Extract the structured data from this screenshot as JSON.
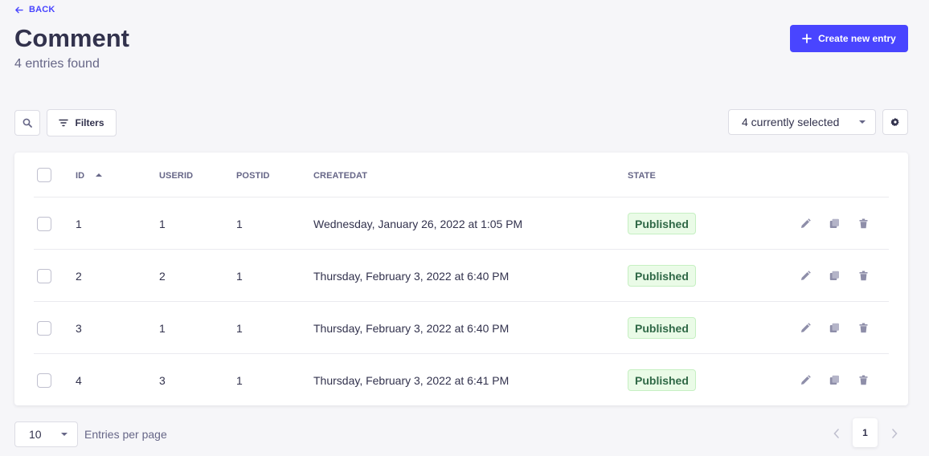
{
  "header": {
    "back_label": "BACK",
    "title": "Comment",
    "subtitle": "4 entries found",
    "create_label": "Create new entry"
  },
  "toolbar": {
    "filters_label": "Filters",
    "columns_select": "4 currently selected"
  },
  "table": {
    "columns": [
      "ID",
      "USERID",
      "POSTID",
      "CREATEDAT",
      "STATE"
    ],
    "rows": [
      {
        "id": "1",
        "userid": "1",
        "postid": "1",
        "createdat": "Wednesday, January 26, 2022 at 1:05 PM",
        "state": "Published"
      },
      {
        "id": "2",
        "userid": "2",
        "postid": "1",
        "createdat": "Thursday, February 3, 2022 at 6:40 PM",
        "state": "Published"
      },
      {
        "id": "3",
        "userid": "1",
        "postid": "1",
        "createdat": "Thursday, February 3, 2022 at 6:40 PM",
        "state": "Published"
      },
      {
        "id": "4",
        "userid": "3",
        "postid": "1",
        "createdat": "Thursday, February 3, 2022 at 6:41 PM",
        "state": "Published"
      }
    ]
  },
  "footer": {
    "per_page_value": "10",
    "per_page_label": "Entries per page",
    "current_page": "1"
  },
  "colors": {
    "accent": "#4945ff",
    "published_bg": "#eafbe7",
    "published_text": "#2f6846"
  },
  "icons": [
    "arrow-left-icon",
    "plus-icon",
    "search-icon",
    "filter-icon",
    "chevron-down-icon",
    "gear-icon",
    "sort-up-icon",
    "pencil-icon",
    "duplicate-icon",
    "trash-icon",
    "chevron-left-icon",
    "chevron-right-icon"
  ]
}
